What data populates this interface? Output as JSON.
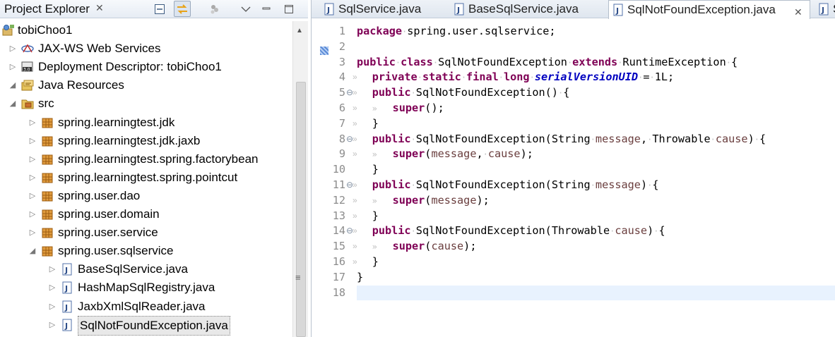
{
  "explorer": {
    "title": "Project Explorer",
    "tree": [
      {
        "label": "tobiChoo1",
        "icon": "project-icon",
        "arrow": "",
        "depth": 0
      },
      {
        "label": "JAX-WS Web Services",
        "icon": "webservices-icon",
        "arrow": "▷",
        "depth": 1
      },
      {
        "label": "Deployment Descriptor: tobiChoo1",
        "icon": "deployment-descriptor-icon",
        "arrow": "▷",
        "depth": 1
      },
      {
        "label": "Java Resources",
        "icon": "java-resources-icon",
        "arrow": "◢",
        "depth": 1
      },
      {
        "label": "src",
        "icon": "source-folder-icon",
        "arrow": "◢",
        "depth": 2
      },
      {
        "label": "spring.learningtest.jdk",
        "icon": "package-icon",
        "arrow": "▷",
        "depth": 3
      },
      {
        "label": "spring.learningtest.jdk.jaxb",
        "icon": "package-icon",
        "arrow": "▷",
        "depth": 3
      },
      {
        "label": "spring.learningtest.spring.factorybean",
        "icon": "package-icon",
        "arrow": "▷",
        "depth": 3
      },
      {
        "label": "spring.learningtest.spring.pointcut",
        "icon": "package-icon",
        "arrow": "▷",
        "depth": 3
      },
      {
        "label": "spring.user.dao",
        "icon": "package-icon",
        "arrow": "▷",
        "depth": 3
      },
      {
        "label": "spring.user.domain",
        "icon": "package-icon",
        "arrow": "▷",
        "depth": 3
      },
      {
        "label": "spring.user.service",
        "icon": "package-icon",
        "arrow": "▷",
        "depth": 3
      },
      {
        "label": "spring.user.sqlservice",
        "icon": "package-icon",
        "arrow": "◢",
        "depth": 3
      },
      {
        "label": "BaseSqlService.java",
        "icon": "java-file-icon",
        "arrow": "▷",
        "depth": 4
      },
      {
        "label": "HashMapSqlRegistry.java",
        "icon": "java-file-icon",
        "arrow": "▷",
        "depth": 4
      },
      {
        "label": "JaxbXmlSqlReader.java",
        "icon": "java-file-icon",
        "arrow": "▷",
        "depth": 4
      },
      {
        "label": "SqlNotFoundException.java",
        "icon": "java-file-icon",
        "arrow": "▷",
        "depth": 4,
        "selected": true
      }
    ]
  },
  "editor": {
    "tabs": [
      {
        "label": "SqlService.java",
        "active": false
      },
      {
        "label": "BaseSqlService.java",
        "active": false
      },
      {
        "label": "SqlNotFoundException.java",
        "active": true
      },
      {
        "label": "S",
        "active": false
      }
    ],
    "lines": [
      {
        "n": "1",
        "fold": "",
        "ws": "",
        "tokens": [
          [
            "kw",
            "package"
          ],
          [
            "ws",
            "·"
          ],
          [
            "t",
            "spring.user.sqlservice;"
          ]
        ]
      },
      {
        "n": "2",
        "fold": "",
        "ws": "",
        "tokens": []
      },
      {
        "n": "3",
        "fold": "",
        "ws": "",
        "tokens": [
          [
            "kw",
            "public"
          ],
          [
            "ws",
            "·"
          ],
          [
            "kw",
            "class"
          ],
          [
            "ws",
            "·"
          ],
          [
            "t",
            "SqlNotFoundException"
          ],
          [
            "ws",
            "·"
          ],
          [
            "kw",
            "extends"
          ],
          [
            "ws",
            "·"
          ],
          [
            "t",
            "RuntimeException"
          ],
          [
            "ws",
            "·"
          ],
          [
            "t",
            "{"
          ]
        ]
      },
      {
        "n": "4",
        "fold": "",
        "ws": "»",
        "tokens": [
          [
            "ws",
            "   "
          ],
          [
            "kw",
            "private"
          ],
          [
            "ws",
            "·"
          ],
          [
            "kw",
            "static"
          ],
          [
            "ws",
            "·"
          ],
          [
            "kw",
            "final"
          ],
          [
            "ws",
            "·"
          ],
          [
            "kw",
            "long"
          ],
          [
            "ws",
            "·"
          ],
          [
            "fld",
            "serialVersionUID"
          ],
          [
            "ws",
            "·"
          ],
          [
            "t",
            "="
          ],
          [
            "ws",
            "·"
          ],
          [
            "t",
            "1L;"
          ]
        ]
      },
      {
        "n": "5",
        "fold": "⊖",
        "ws": "»",
        "tokens": [
          [
            "ws",
            "   "
          ],
          [
            "kw",
            "public"
          ],
          [
            "ws",
            "·"
          ],
          [
            "t",
            "SqlNotFoundException()"
          ],
          [
            "ws",
            "·"
          ],
          [
            "t",
            "{"
          ]
        ]
      },
      {
        "n": "6",
        "fold": "",
        "ws": "»",
        "tokens": [
          [
            "ws",
            "   »   "
          ],
          [
            "kw",
            "super"
          ],
          [
            "t",
            "();"
          ]
        ]
      },
      {
        "n": "7",
        "fold": "",
        "ws": "»",
        "tokens": [
          [
            "ws",
            "   "
          ],
          [
            "t",
            "}"
          ]
        ]
      },
      {
        "n": "8",
        "fold": "⊖",
        "ws": "»",
        "tokens": [
          [
            "ws",
            "   "
          ],
          [
            "kw",
            "public"
          ],
          [
            "ws",
            "·"
          ],
          [
            "t",
            "SqlNotFoundException(String"
          ],
          [
            "ws",
            "·"
          ],
          [
            "par",
            "message"
          ],
          [
            "t",
            ","
          ],
          [
            "ws",
            "·"
          ],
          [
            "t",
            "Throwable"
          ],
          [
            "ws",
            "·"
          ],
          [
            "par",
            "cause"
          ],
          [
            "t",
            ")"
          ],
          [
            "ws",
            "·"
          ],
          [
            "t",
            "{"
          ]
        ]
      },
      {
        "n": "9",
        "fold": "",
        "ws": "»",
        "tokens": [
          [
            "ws",
            "   »   "
          ],
          [
            "kw",
            "super"
          ],
          [
            "t",
            "("
          ],
          [
            "par",
            "message"
          ],
          [
            "t",
            ","
          ],
          [
            "ws",
            "·"
          ],
          [
            "par",
            "cause"
          ],
          [
            "t",
            ");"
          ]
        ]
      },
      {
        "n": "10",
        "fold": "",
        "ws": "",
        "tokens": [
          [
            "ws",
            "   "
          ],
          [
            "t",
            "}"
          ]
        ]
      },
      {
        "n": "11",
        "fold": "⊖",
        "ws": "»",
        "tokens": [
          [
            "ws",
            "   "
          ],
          [
            "kw",
            "public"
          ],
          [
            "ws",
            "·"
          ],
          [
            "t",
            "SqlNotFoundException(String"
          ],
          [
            "ws",
            "·"
          ],
          [
            "par",
            "message"
          ],
          [
            "t",
            ")"
          ],
          [
            "ws",
            "·"
          ],
          [
            "t",
            "{"
          ]
        ]
      },
      {
        "n": "12",
        "fold": "",
        "ws": "»",
        "tokens": [
          [
            "ws",
            "   »   "
          ],
          [
            "kw",
            "super"
          ],
          [
            "t",
            "("
          ],
          [
            "par",
            "message"
          ],
          [
            "t",
            ");"
          ]
        ]
      },
      {
        "n": "13",
        "fold": "",
        "ws": "»",
        "tokens": [
          [
            "ws",
            "   "
          ],
          [
            "t",
            "}"
          ]
        ]
      },
      {
        "n": "14",
        "fold": "⊖",
        "ws": "»",
        "tokens": [
          [
            "ws",
            "   "
          ],
          [
            "kw",
            "public"
          ],
          [
            "ws",
            "·"
          ],
          [
            "t",
            "SqlNotFoundException(Throwable"
          ],
          [
            "ws",
            "·"
          ],
          [
            "par",
            "cause"
          ],
          [
            "t",
            ")"
          ],
          [
            "ws",
            "·"
          ],
          [
            "t",
            "{"
          ]
        ]
      },
      {
        "n": "15",
        "fold": "",
        "ws": "»",
        "tokens": [
          [
            "ws",
            "   »   "
          ],
          [
            "kw",
            "super"
          ],
          [
            "t",
            "("
          ],
          [
            "par",
            "cause"
          ],
          [
            "t",
            ");"
          ]
        ]
      },
      {
        "n": "16",
        "fold": "",
        "ws": "»",
        "tokens": [
          [
            "ws",
            "   "
          ],
          [
            "t",
            "}"
          ]
        ]
      },
      {
        "n": "17",
        "fold": "",
        "ws": "",
        "tokens": [
          [
            "t",
            "}"
          ]
        ]
      },
      {
        "n": "18",
        "fold": "",
        "ws": "",
        "tokens": [],
        "current": true
      }
    ]
  },
  "colors": {
    "keyword": "#7f0055",
    "field": "#0000c0",
    "param": "#6a3e3e",
    "current_line": "#e8f2fe"
  }
}
